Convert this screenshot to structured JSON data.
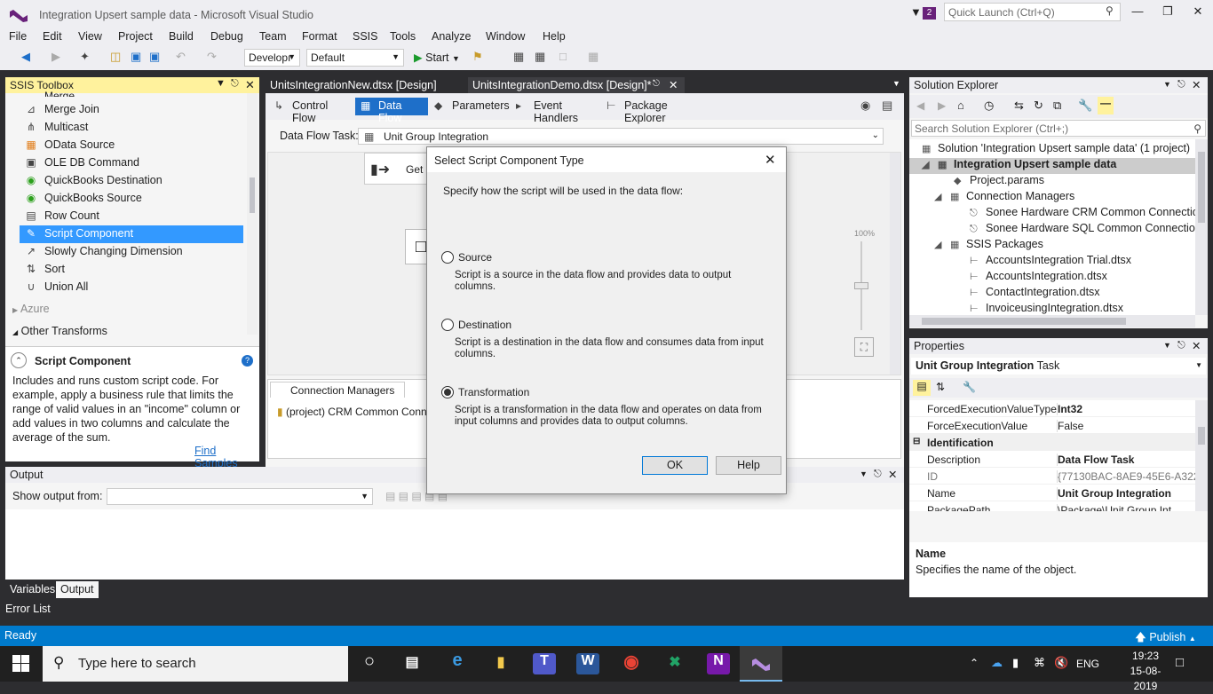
{
  "window": {
    "title": "Integration Upsert sample data - Microsoft Visual Studio",
    "notification_count": "2",
    "quick_launch_placeholder": "Quick Launch (Ctrl+Q)"
  },
  "menu": [
    "File",
    "Edit",
    "View",
    "Project",
    "Build",
    "Debug",
    "Team",
    "Format",
    "SSIS",
    "Tools",
    "Analyze",
    "Window",
    "Help"
  ],
  "toolbar": {
    "config": "Developı",
    "platform": "Default",
    "start": "Start"
  },
  "toolbox": {
    "title": "SSIS Toolbox",
    "partial_item": "Merge",
    "items": [
      {
        "label": "Merge Join",
        "icon": "merge-join-icon"
      },
      {
        "label": "Multicast",
        "icon": "multicast-icon"
      },
      {
        "label": "OData Source",
        "icon": "odata-icon"
      },
      {
        "label": "OLE DB Command",
        "icon": "oledb-icon"
      },
      {
        "label": "QuickBooks Destination",
        "icon": "quickbooks-icon"
      },
      {
        "label": "QuickBooks Source",
        "icon": "quickbooks-icon"
      },
      {
        "label": "Row Count",
        "icon": "row-count-icon"
      },
      {
        "label": "Script Component",
        "icon": "script-icon"
      },
      {
        "label": "Slowly Changing Dimension",
        "icon": "scd-icon"
      },
      {
        "label": "Sort",
        "icon": "sort-icon"
      },
      {
        "label": "Union All",
        "icon": "union-icon"
      }
    ],
    "groups": [
      "Azure",
      "Other Transforms"
    ],
    "desc_title": "Script Component",
    "desc_text": "Includes and runs custom script code. For example, apply a business rule that limits the range of valid values in an \"income\" column or add values in two columns and calculate the average of the sum.",
    "find_samples": "Find Samples"
  },
  "documents": {
    "tabs": [
      "UnitsIntegrationNew.dtsx [Design]",
      "UnitsIntegrationDemo.dtsx [Design]*"
    ],
    "design_tabs": [
      "Control Flow",
      "Data Flow",
      "Parameters",
      "Event Handlers",
      "Package Explorer"
    ],
    "data_flow_task_label": "Data Flow Task:",
    "data_flow_task_value": "Unit Group Integration",
    "canvas_component_partial": "Get U",
    "zoom": "100%",
    "connection_managers_tab": "Connection Managers",
    "connection_item": "(project) CRM Common Connecti"
  },
  "output": {
    "title": "Output",
    "show_from_label": "Show output from:",
    "bottom_tabs": [
      "Variables",
      "Output"
    ],
    "error_list": "Error List"
  },
  "solution_explorer": {
    "title": "Solution Explorer",
    "search_placeholder": "Search Solution Explorer (Ctrl+;)",
    "tree": [
      "Solution 'Integration Upsert sample data' (1 project)",
      "Integration Upsert sample data",
      "Project.params",
      "Connection Managers",
      "Sonee Hardware CRM Common Connection",
      "Sonee Hardware SQL Common Connection",
      "SSIS Packages",
      "AccountsIntegration Trial.dtsx",
      "AccountsIntegration.dtsx",
      "ContactIntegration.dtsx",
      "InvoiceusingIntegration.dtsx"
    ]
  },
  "properties": {
    "title": "Properties",
    "object": "Unit Group Integration",
    "object_type": "Task",
    "rows": [
      {
        "key": "ForcedExecutionValueType",
        "value": "Int32"
      },
      {
        "key": "ForceExecutionValue",
        "value": "False"
      },
      {
        "key": "Identification",
        "value": ""
      },
      {
        "key": "Description",
        "value": "Data Flow Task"
      },
      {
        "key": "ID",
        "value": "{77130BAC-8AE9-45E6-A322-"
      },
      {
        "key": "Name",
        "value": "Unit Group Integration"
      },
      {
        "key": "PackagePath",
        "value": "\\Package\\Unit Group Int"
      }
    ],
    "desc_name": "Name",
    "desc_text": "Specifies the name of the object."
  },
  "status": {
    "text": "Ready",
    "publish": "Publish"
  },
  "taskbar": {
    "search": "Type here to search",
    "lang": "ENG",
    "time": "19:23",
    "date": "15-08-2019"
  },
  "dialog": {
    "title": "Select Script Component Type",
    "instruction": "Specify how the script will be used in the data flow:",
    "options": [
      {
        "label": "Source",
        "desc": "Script is a source in the data flow and provides data to output columns.",
        "selected": false
      },
      {
        "label": "Destination",
        "desc": "Script is a destination in the data flow and consumes data from input columns.",
        "selected": false
      },
      {
        "label": "Transformation",
        "desc": "Script is a transformation in the data flow and operates on data from input columns and provides data to output columns.",
        "selected": true
      }
    ],
    "ok": "OK",
    "help": "Help"
  }
}
